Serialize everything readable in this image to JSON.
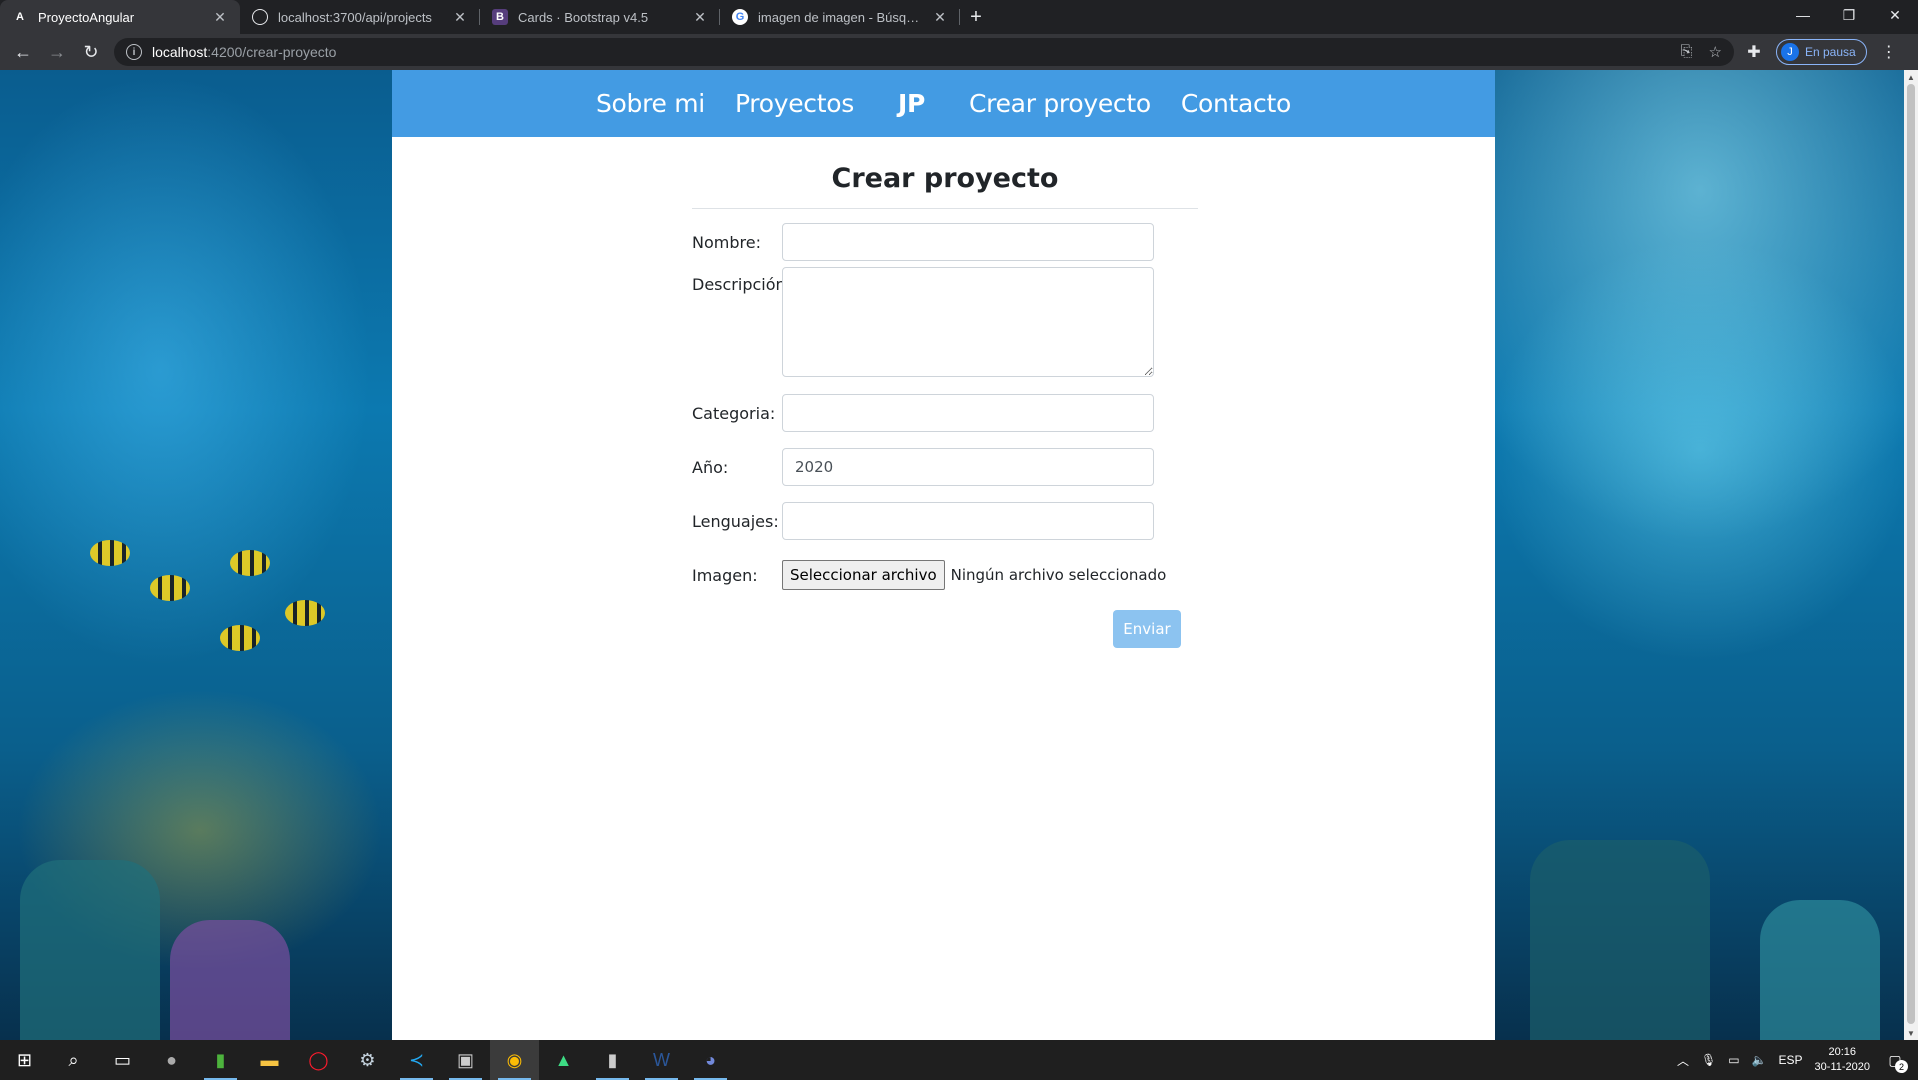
{
  "browser": {
    "tabs": [
      {
        "title": "ProyectoAngular",
        "favicon": "A",
        "active": true
      },
      {
        "title": "localhost:3700/api/projects",
        "favicon": "globe",
        "active": false
      },
      {
        "title": "Cards · Bootstrap v4.5",
        "favicon": "B",
        "active": false
      },
      {
        "title": "imagen de imagen - Búsqueda de Google",
        "favicon": "G",
        "active": false
      }
    ],
    "url_host": "localhost",
    "url_path": ":4200/crear-proyecto",
    "profile_initial": "J",
    "profile_label": "En pausa"
  },
  "nav": {
    "items": [
      "Sobre mi",
      "Proyectos",
      "JP",
      "Crear proyecto",
      "Contacto"
    ]
  },
  "form": {
    "title": "Crear proyecto",
    "fields": {
      "nombre": {
        "label": "Nombre:",
        "value": ""
      },
      "descripcion": {
        "label": "Descripción:",
        "value": ""
      },
      "categoria": {
        "label": "Categoria:",
        "value": ""
      },
      "anio": {
        "label": "Año:",
        "value": "2020"
      },
      "lenguajes": {
        "label": "Lenguajes:",
        "value": ""
      },
      "imagen": {
        "label": "Imagen:",
        "button": "Seleccionar archivo",
        "status": "Ningún archivo seleccionado"
      }
    },
    "submit_label": "Enviar"
  },
  "taskbar": {
    "language": "ESP",
    "time": "20:16",
    "date": "30-11-2020",
    "notifications": "2"
  },
  "colors": {
    "nav_bg": "#439be3",
    "submit_bg": "#8cc3f0"
  }
}
